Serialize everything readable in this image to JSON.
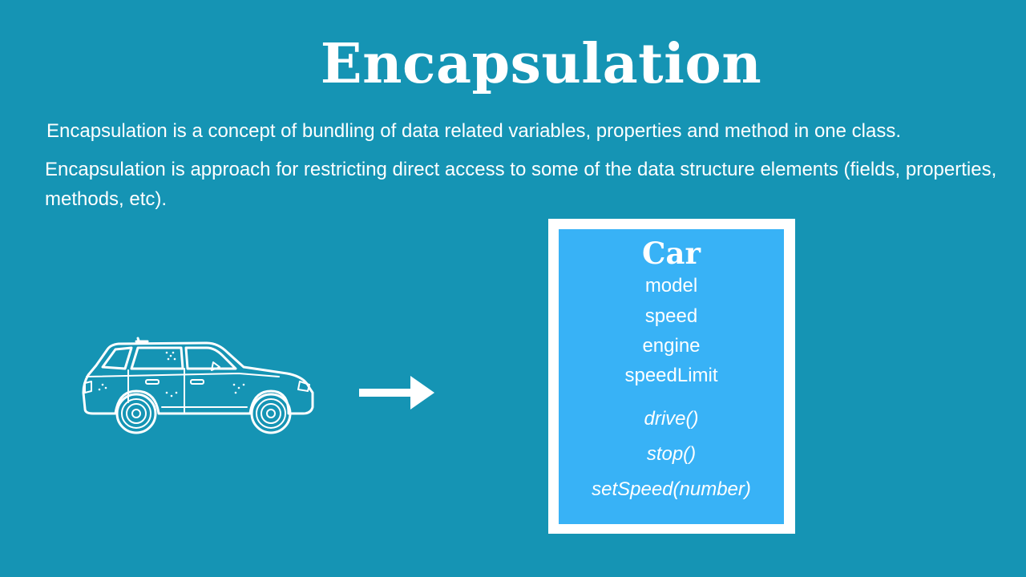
{
  "title": "Encapsulation",
  "descriptions": [
    "Encapsulation is a concept of bundling of data related variables, properties and method in one class.",
    "Encapsulation is approach for restricting direct access to some of the data structure elements (fields, properties, methods, etc)."
  ],
  "icons": {
    "car": "car-icon",
    "arrow": "arrow-right-icon"
  },
  "class_box": {
    "name": "Car",
    "properties": [
      "model",
      "speed",
      "engine",
      "speedLimit"
    ],
    "methods": [
      "drive()",
      "stop()",
      "setSpeed(number)"
    ]
  },
  "colors": {
    "background": "#1594b4",
    "class_fill": "#38b2f6",
    "class_border": "#ffffff",
    "text": "#ffffff"
  }
}
